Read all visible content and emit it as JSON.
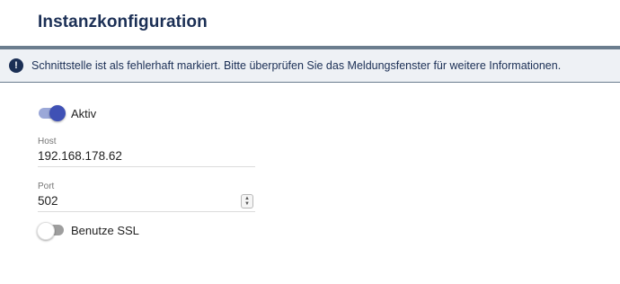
{
  "header": {
    "title": "Instanzkonfiguration"
  },
  "banner": {
    "icon": "alert-circle-icon",
    "message": "Schnittstelle ist als fehlerhaft markiert. Bitte überprüfen Sie das Meldungsfenster für weitere Informationen."
  },
  "form": {
    "active": {
      "label": "Aktiv",
      "checked": true
    },
    "host": {
      "label": "Host",
      "value": "192.168.178.62"
    },
    "port": {
      "label": "Port",
      "value": "502"
    },
    "ssl": {
      "label": "Benutze SSL",
      "checked": false
    }
  },
  "colors": {
    "title": "#1b2f55",
    "accent": "#3f51b5",
    "banner_bg": "#eef1f5",
    "rule": "#6b7d8e"
  }
}
